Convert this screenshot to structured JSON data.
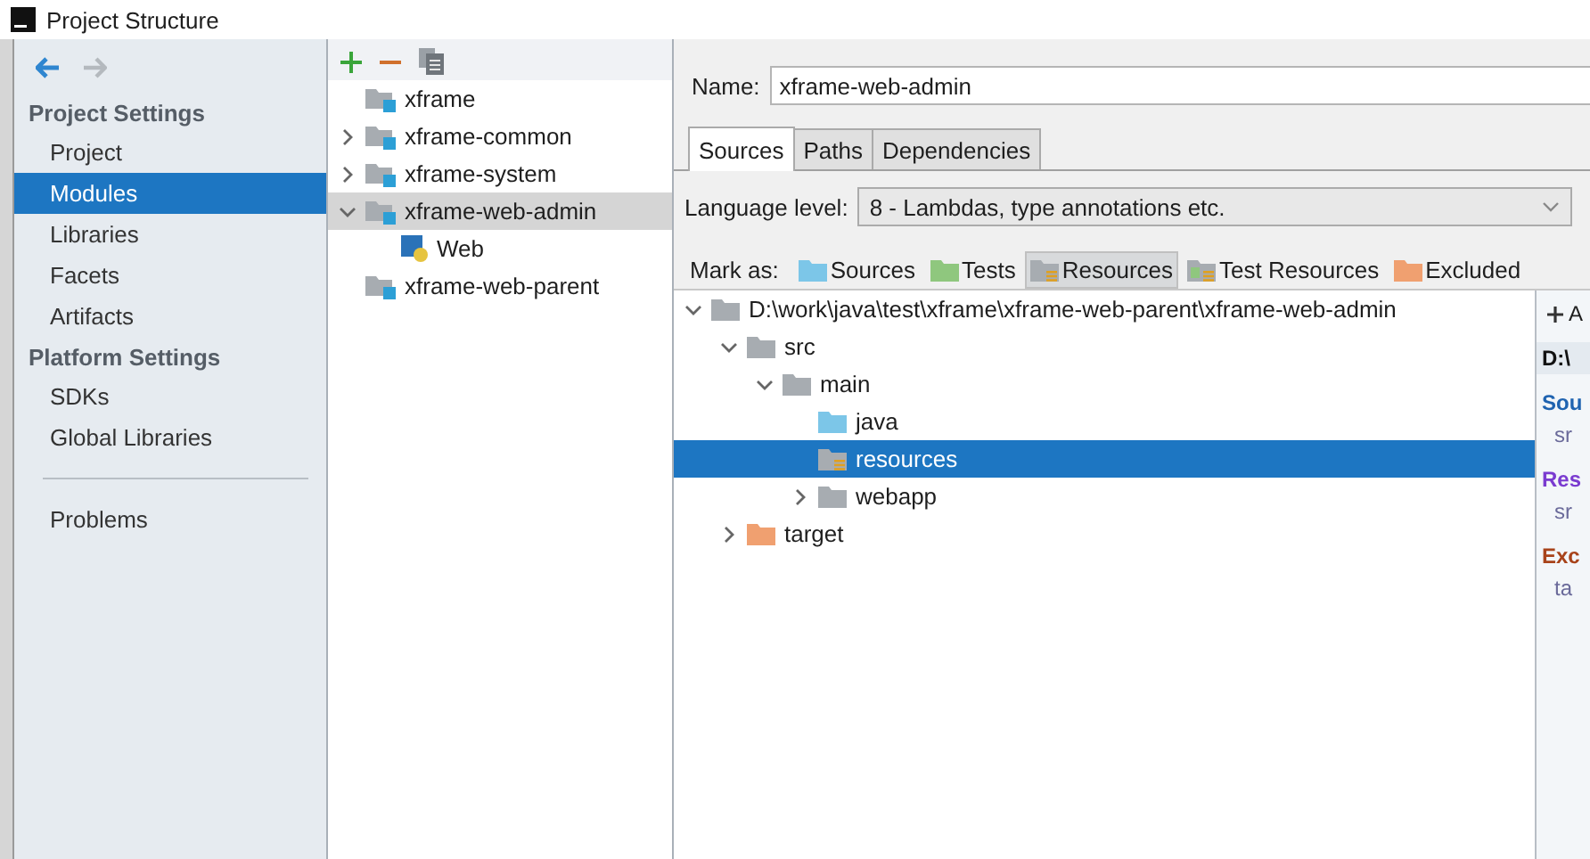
{
  "window": {
    "title": "Project Structure"
  },
  "sidebar": {
    "sections": [
      {
        "title": "Project Settings",
        "items": [
          {
            "label": "Project",
            "selected": false
          },
          {
            "label": "Modules",
            "selected": true
          },
          {
            "label": "Libraries",
            "selected": false
          },
          {
            "label": "Facets",
            "selected": false
          },
          {
            "label": "Artifacts",
            "selected": false
          }
        ]
      },
      {
        "title": "Platform Settings",
        "items": [
          {
            "label": "SDKs",
            "selected": false
          },
          {
            "label": "Global Libraries",
            "selected": false
          }
        ]
      }
    ],
    "footer_items": [
      {
        "label": "Problems",
        "selected": false
      }
    ]
  },
  "modules": [
    {
      "name": "xframe",
      "kind": "module",
      "selected": false
    },
    {
      "name": "xframe-common",
      "kind": "module",
      "selected": false,
      "expanded": false
    },
    {
      "name": "xframe-system",
      "kind": "module",
      "selected": false,
      "expanded": false
    },
    {
      "name": "xframe-web-admin",
      "kind": "module",
      "selected": true,
      "expanded": true,
      "children": [
        {
          "name": "Web",
          "kind": "web",
          "selected": false
        }
      ]
    },
    {
      "name": "xframe-web-parent",
      "kind": "module",
      "selected": false
    }
  ],
  "name_field": {
    "label": "Name:",
    "value": "xframe-web-admin"
  },
  "tabs": [
    {
      "label": "Sources",
      "selected": true
    },
    {
      "label": "Paths",
      "selected": false
    },
    {
      "label": "Dependencies",
      "selected": false
    }
  ],
  "language_level": {
    "label": "Language level:",
    "value": "8 - Lambdas, type annotations etc."
  },
  "mark_as": {
    "label": "Mark as:",
    "buttons": [
      {
        "label": "Sources",
        "kind": "sources",
        "selected": false
      },
      {
        "label": "Tests",
        "kind": "tests",
        "selected": false
      },
      {
        "label": "Resources",
        "kind": "resources",
        "selected": true
      },
      {
        "label": "Test Resources",
        "kind": "test_resources",
        "selected": false
      },
      {
        "label": "Excluded",
        "kind": "excluded",
        "selected": false
      }
    ]
  },
  "content_tree": [
    {
      "name": "D:\\work\\java\\test\\xframe\\xframe-web-parent\\xframe-web-admin",
      "kind": "folder",
      "selected": false,
      "expanded": true,
      "children": [
        {
          "name": "src",
          "kind": "folder",
          "selected": false,
          "expanded": true,
          "children": [
            {
              "name": "main",
              "kind": "folder",
              "selected": false,
              "expanded": true,
              "children": [
                {
                  "name": "java",
                  "kind": "sources",
                  "selected": false
                },
                {
                  "name": "resources",
                  "kind": "resources",
                  "selected": true
                },
                {
                  "name": "webapp",
                  "kind": "folder",
                  "selected": false,
                  "expanded": false
                }
              ]
            }
          ]
        },
        {
          "name": "target",
          "kind": "excluded",
          "selected": false,
          "expanded": false
        }
      ]
    }
  ],
  "roots_panel": {
    "add_label": "A",
    "entries": [
      {
        "kind": "header",
        "text": "D:\\"
      },
      {
        "kind": "sources",
        "text": "Sou"
      },
      {
        "kind": "path",
        "text": "sr"
      },
      {
        "kind": "resources",
        "text": "Res"
      },
      {
        "kind": "path",
        "text": "sr"
      },
      {
        "kind": "excluded",
        "text": "Exc"
      },
      {
        "kind": "path",
        "text": "ta"
      }
    ]
  }
}
